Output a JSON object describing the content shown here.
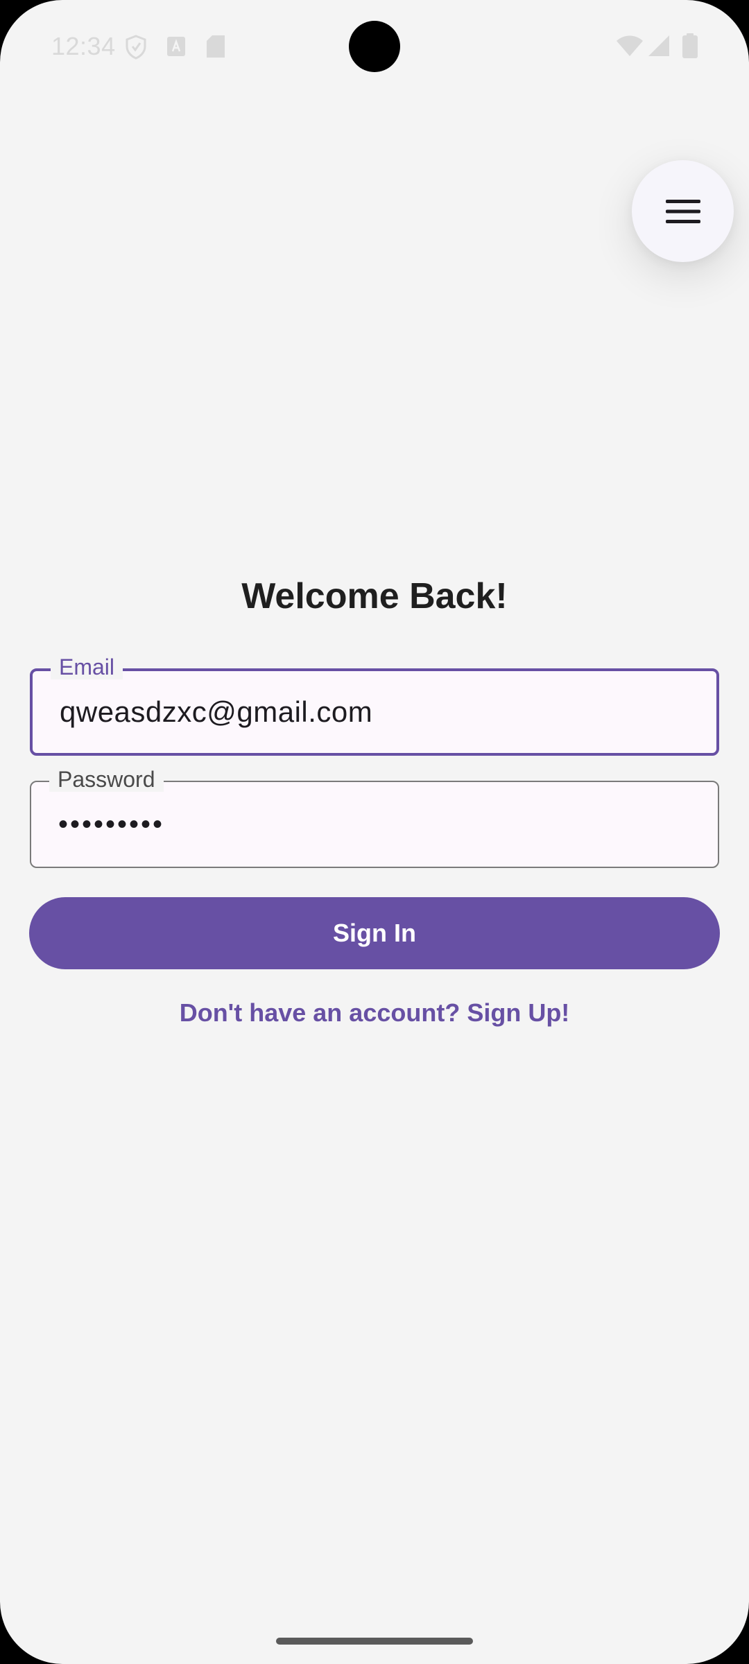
{
  "status_bar": {
    "time": "12:34",
    "left_icons": [
      "shield-icon",
      "a-box-icon",
      "sd-card-icon"
    ],
    "right_icons": [
      "wifi-icon",
      "signal-icon",
      "battery-icon"
    ]
  },
  "menu": {
    "icon": "hamburger-menu-icon"
  },
  "login": {
    "title": "Welcome Back!",
    "email_label": "Email",
    "email_value": "qweasdzxc@gmail.com",
    "password_label": "Password",
    "password_value": "•••••••••",
    "sign_in_label": "Sign In",
    "signup_prompt": "Don't have an account? Sign Up!"
  },
  "colors": {
    "accent": "#6750a4",
    "background": "#f4f4f4",
    "field_fill": "#fdf8fd"
  }
}
